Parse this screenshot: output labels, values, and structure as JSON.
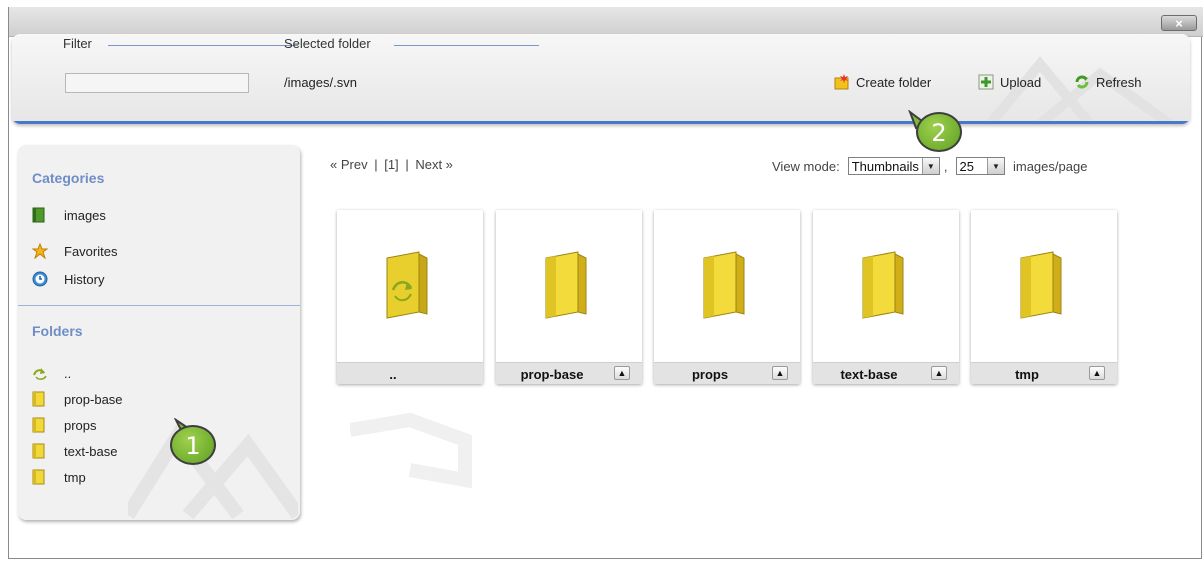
{
  "window": {
    "close_label": "×"
  },
  "toolbar": {
    "filter_label": "Filter",
    "filter_value": "",
    "selected_folder_label": "Selected folder",
    "selected_folder_path": "/images/.svn",
    "create_folder_label": "Create folder",
    "upload_label": "Upload",
    "refresh_label": "Refresh"
  },
  "sidebar": {
    "categories_title": "Categories",
    "categories": [
      {
        "label": "images",
        "icon": "book-icon"
      },
      {
        "label": "Favorites",
        "icon": "star-icon"
      },
      {
        "label": "History",
        "icon": "clock-icon"
      }
    ],
    "folders_title": "Folders",
    "folders": [
      {
        "label": "..",
        "icon": "folder-up-icon"
      },
      {
        "label": "prop-base",
        "icon": "folder-icon"
      },
      {
        "label": "props",
        "icon": "folder-icon"
      },
      {
        "label": "text-base",
        "icon": "folder-icon"
      },
      {
        "label": "tmp",
        "icon": "folder-icon"
      }
    ]
  },
  "pager": {
    "prev": "« Prev",
    "sep1": "|",
    "current": "[1]",
    "sep2": "|",
    "next": "Next »"
  },
  "view": {
    "mode_label": "View mode:",
    "mode_value": "Thumbnails",
    "comma": ",",
    "per_page_value": "25",
    "per_page_label": "images/page"
  },
  "thumbnails": [
    {
      "name": "..",
      "type": "parent",
      "has_arrow": false
    },
    {
      "name": "prop-base",
      "type": "folder",
      "has_arrow": true
    },
    {
      "name": "props",
      "type": "folder",
      "has_arrow": true
    },
    {
      "name": "text-base",
      "type": "folder",
      "has_arrow": true
    },
    {
      "name": "tmp",
      "type": "folder",
      "has_arrow": true
    }
  ],
  "callouts": [
    {
      "number": "1"
    },
    {
      "number": "2"
    }
  ],
  "colors": {
    "accent_blue": "#4a78c8",
    "heading_blue": "#6f8ec6",
    "callout_green": "#7cb93a",
    "folder_yellow": "#f2d93a"
  }
}
